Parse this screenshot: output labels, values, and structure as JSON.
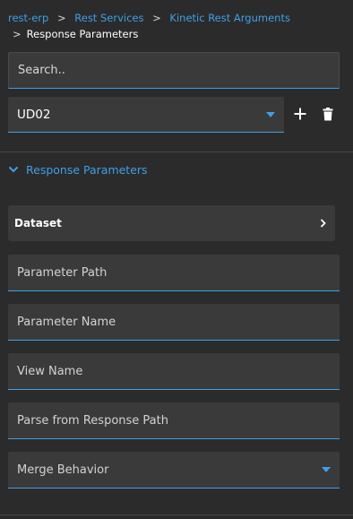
{
  "breadcrumb": {
    "items": [
      "rest-erp",
      "Rest Services",
      "Kinetic Rest Arguments"
    ],
    "current": "Response Parameters",
    "separator": ">"
  },
  "search": {
    "placeholder": "Search.."
  },
  "selector": {
    "value": "UD02"
  },
  "section": {
    "title": "Response Parameters"
  },
  "dataset": {
    "label": "Dataset"
  },
  "fields": {
    "parameter_path": "Parameter Path",
    "parameter_name": "Parameter Name",
    "view_name": "View Name",
    "parse_from_response_path": "Parse from Response Path",
    "merge_behavior": "Merge Behavior"
  },
  "icons": {
    "add": "plus-icon",
    "delete": "trash-icon",
    "section_toggle": "chevron-down-icon",
    "dataset_open": "chevron-right-icon",
    "dropdown": "caret-down-icon"
  },
  "colors": {
    "accent": "#3ea0e6",
    "background": "#2b2b2b",
    "field_background": "#3a3a3a"
  }
}
